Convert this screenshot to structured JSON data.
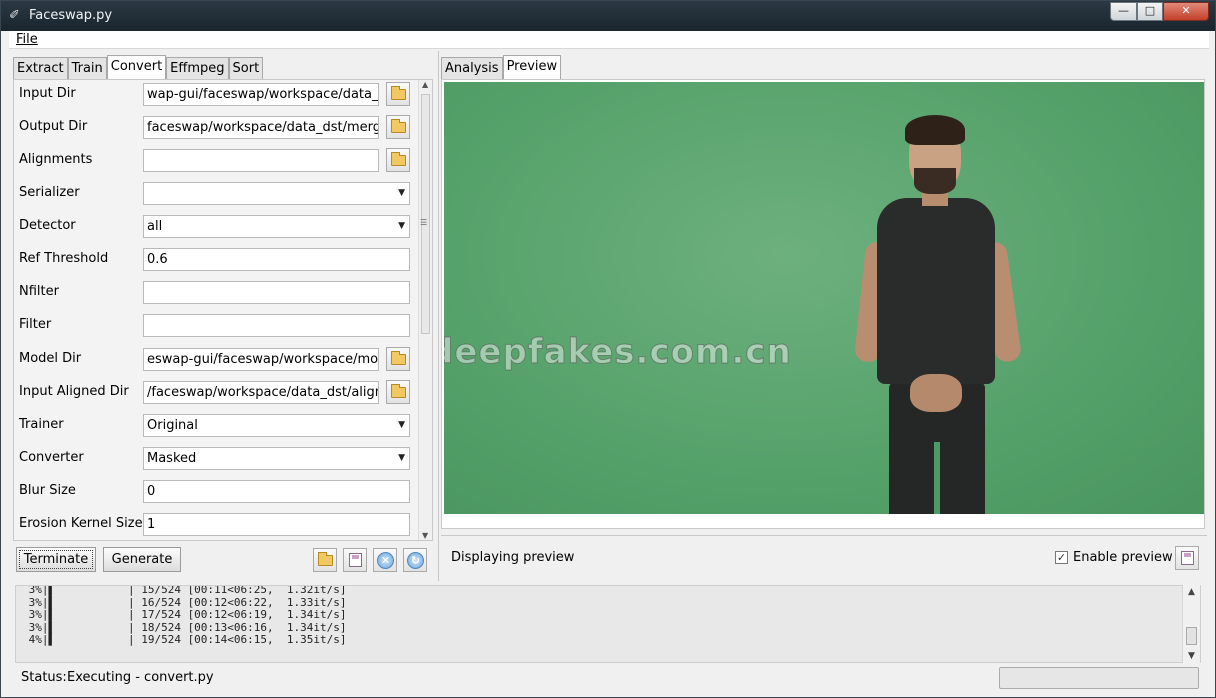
{
  "window": {
    "title": "Faceswap.py",
    "controls": {
      "minimize": "—",
      "maximize": "□",
      "close": "✕"
    }
  },
  "menu": {
    "file": "File"
  },
  "left_tabs": [
    "Extract",
    "Train",
    "Convert",
    "Effmpeg",
    "Sort"
  ],
  "active_left_tab": "Convert",
  "fields": [
    {
      "label": "Input Dir",
      "value": "wap-gui/faceswap/workspace/data_dst",
      "type": "folder"
    },
    {
      "label": "Output Dir",
      "value": "faceswap/workspace/data_dst/merged",
      "type": "folder"
    },
    {
      "label": "Alignments",
      "value": "",
      "type": "folder"
    },
    {
      "label": "Serializer",
      "value": "",
      "type": "select"
    },
    {
      "label": "Detector",
      "value": "all",
      "type": "select"
    },
    {
      "label": "Ref Threshold",
      "value": "0.6",
      "type": "text"
    },
    {
      "label": "Nfilter",
      "value": "",
      "type": "text"
    },
    {
      "label": "Filter",
      "value": "",
      "type": "text"
    },
    {
      "label": "Model Dir",
      "value": "eswap-gui/faceswap/workspace/model",
      "type": "folder"
    },
    {
      "label": "Input Aligned Dir",
      "value": "/faceswap/workspace/data_dst/aligned",
      "type": "folder"
    },
    {
      "label": "Trainer",
      "value": "Original",
      "type": "select"
    },
    {
      "label": "Converter",
      "value": "Masked",
      "type": "select"
    },
    {
      "label": "Blur Size",
      "value": "0",
      "type": "text"
    },
    {
      "label": "Erosion Kernel Size",
      "value": "1",
      "type": "text"
    }
  ],
  "actions": {
    "terminate": "Terminate",
    "generate": "Generate",
    "icons": [
      "open-folder-icon",
      "save-icon",
      "clear-icon",
      "reset-icon"
    ]
  },
  "right_tabs": [
    "Analysis",
    "Preview"
  ],
  "active_right_tab": "Preview",
  "preview": {
    "watermark": "deepfakes.com.cn",
    "status_label": "Displaying preview",
    "enable_label": "Enable preview",
    "enable_checked": true
  },
  "console": [
    " 3%|▌           | 15/524 [00:11<06:25,  1.32it/s]",
    " 3%|▌           | 16/524 [00:12<06:22,  1.33it/s]",
    " 3%|▌           | 17/524 [00:12<06:19,  1.34it/s]",
    " 3%|▌           | 18/524 [00:13<06:16,  1.34it/s]",
    " 4%|▌           | 19/524 [00:14<06:15,  1.35it/s]"
  ],
  "status": {
    "label": "Status:",
    "value": "Executing - convert.py",
    "progress_fraction": 0.0
  }
}
